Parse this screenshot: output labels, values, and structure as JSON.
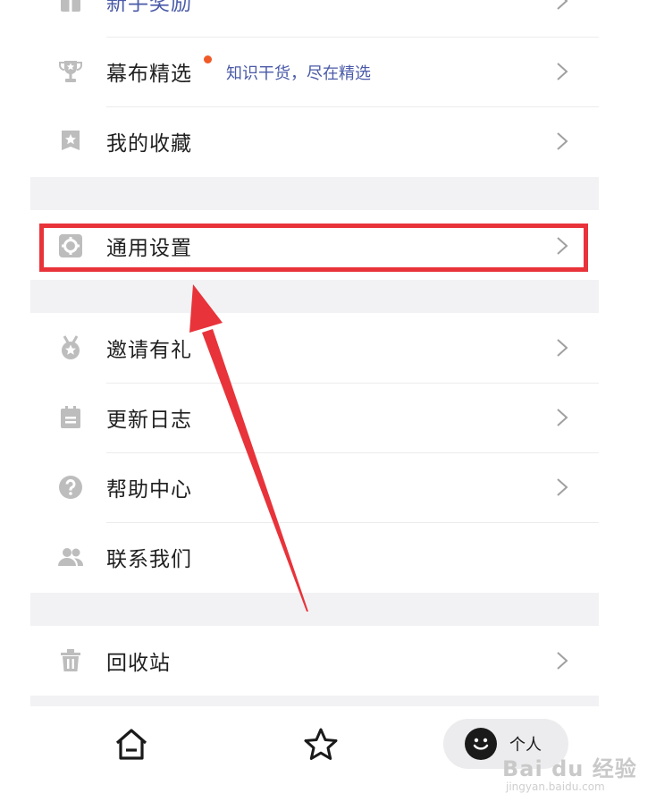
{
  "menu_top": [
    {
      "label": "新手奖励",
      "icon": "gift-icon"
    },
    {
      "label": "幕布精选",
      "icon": "trophy-icon",
      "badge": "new-dot",
      "subtitle": "知识干货，尽在精选"
    },
    {
      "label": "我的收藏",
      "icon": "bookmark-star-icon"
    }
  ],
  "menu_settings": {
    "label": "通用设置",
    "icon": "gear-icon"
  },
  "menu_middle": [
    {
      "label": "邀请有礼",
      "icon": "medal-icon"
    },
    {
      "label": "更新日志",
      "icon": "calendar-icon"
    },
    {
      "label": "帮助中心",
      "icon": "help-icon"
    },
    {
      "label": "联系我们",
      "icon": "people-icon"
    }
  ],
  "menu_bottom": {
    "label": "回收站",
    "icon": "trash-icon"
  },
  "tabbar": {
    "home_icon": "home-icon",
    "star_icon": "star-icon",
    "profile_label": "个人",
    "profile_icon": "smiley-face-icon"
  },
  "watermark": {
    "main": "Bai du 经验",
    "sub": "jingyan.baidu.com"
  },
  "colors": {
    "highlight_border": "#e8333a",
    "subtitle": "#4a5aa8",
    "badge_dot": "#f05a28",
    "icon_gray": "#bdbdbd",
    "page_bg": "#f2f2f4"
  }
}
